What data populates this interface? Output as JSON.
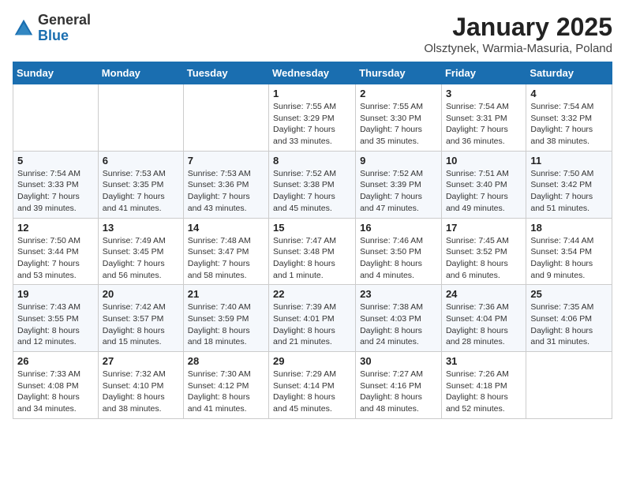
{
  "header": {
    "logo_general": "General",
    "logo_blue": "Blue",
    "month_year": "January 2025",
    "location": "Olsztynek, Warmia-Masuria, Poland"
  },
  "weekdays": [
    "Sunday",
    "Monday",
    "Tuesday",
    "Wednesday",
    "Thursday",
    "Friday",
    "Saturday"
  ],
  "weeks": [
    [
      {
        "day": "",
        "info": ""
      },
      {
        "day": "",
        "info": ""
      },
      {
        "day": "",
        "info": ""
      },
      {
        "day": "1",
        "info": "Sunrise: 7:55 AM\nSunset: 3:29 PM\nDaylight: 7 hours\nand 33 minutes."
      },
      {
        "day": "2",
        "info": "Sunrise: 7:55 AM\nSunset: 3:30 PM\nDaylight: 7 hours\nand 35 minutes."
      },
      {
        "day": "3",
        "info": "Sunrise: 7:54 AM\nSunset: 3:31 PM\nDaylight: 7 hours\nand 36 minutes."
      },
      {
        "day": "4",
        "info": "Sunrise: 7:54 AM\nSunset: 3:32 PM\nDaylight: 7 hours\nand 38 minutes."
      }
    ],
    [
      {
        "day": "5",
        "info": "Sunrise: 7:54 AM\nSunset: 3:33 PM\nDaylight: 7 hours\nand 39 minutes."
      },
      {
        "day": "6",
        "info": "Sunrise: 7:53 AM\nSunset: 3:35 PM\nDaylight: 7 hours\nand 41 minutes."
      },
      {
        "day": "7",
        "info": "Sunrise: 7:53 AM\nSunset: 3:36 PM\nDaylight: 7 hours\nand 43 minutes."
      },
      {
        "day": "8",
        "info": "Sunrise: 7:52 AM\nSunset: 3:38 PM\nDaylight: 7 hours\nand 45 minutes."
      },
      {
        "day": "9",
        "info": "Sunrise: 7:52 AM\nSunset: 3:39 PM\nDaylight: 7 hours\nand 47 minutes."
      },
      {
        "day": "10",
        "info": "Sunrise: 7:51 AM\nSunset: 3:40 PM\nDaylight: 7 hours\nand 49 minutes."
      },
      {
        "day": "11",
        "info": "Sunrise: 7:50 AM\nSunset: 3:42 PM\nDaylight: 7 hours\nand 51 minutes."
      }
    ],
    [
      {
        "day": "12",
        "info": "Sunrise: 7:50 AM\nSunset: 3:44 PM\nDaylight: 7 hours\nand 53 minutes."
      },
      {
        "day": "13",
        "info": "Sunrise: 7:49 AM\nSunset: 3:45 PM\nDaylight: 7 hours\nand 56 minutes."
      },
      {
        "day": "14",
        "info": "Sunrise: 7:48 AM\nSunset: 3:47 PM\nDaylight: 7 hours\nand 58 minutes."
      },
      {
        "day": "15",
        "info": "Sunrise: 7:47 AM\nSunset: 3:48 PM\nDaylight: 8 hours\nand 1 minute."
      },
      {
        "day": "16",
        "info": "Sunrise: 7:46 AM\nSunset: 3:50 PM\nDaylight: 8 hours\nand 4 minutes."
      },
      {
        "day": "17",
        "info": "Sunrise: 7:45 AM\nSunset: 3:52 PM\nDaylight: 8 hours\nand 6 minutes."
      },
      {
        "day": "18",
        "info": "Sunrise: 7:44 AM\nSunset: 3:54 PM\nDaylight: 8 hours\nand 9 minutes."
      }
    ],
    [
      {
        "day": "19",
        "info": "Sunrise: 7:43 AM\nSunset: 3:55 PM\nDaylight: 8 hours\nand 12 minutes."
      },
      {
        "day": "20",
        "info": "Sunrise: 7:42 AM\nSunset: 3:57 PM\nDaylight: 8 hours\nand 15 minutes."
      },
      {
        "day": "21",
        "info": "Sunrise: 7:40 AM\nSunset: 3:59 PM\nDaylight: 8 hours\nand 18 minutes."
      },
      {
        "day": "22",
        "info": "Sunrise: 7:39 AM\nSunset: 4:01 PM\nDaylight: 8 hours\nand 21 minutes."
      },
      {
        "day": "23",
        "info": "Sunrise: 7:38 AM\nSunset: 4:03 PM\nDaylight: 8 hours\nand 24 minutes."
      },
      {
        "day": "24",
        "info": "Sunrise: 7:36 AM\nSunset: 4:04 PM\nDaylight: 8 hours\nand 28 minutes."
      },
      {
        "day": "25",
        "info": "Sunrise: 7:35 AM\nSunset: 4:06 PM\nDaylight: 8 hours\nand 31 minutes."
      }
    ],
    [
      {
        "day": "26",
        "info": "Sunrise: 7:33 AM\nSunset: 4:08 PM\nDaylight: 8 hours\nand 34 minutes."
      },
      {
        "day": "27",
        "info": "Sunrise: 7:32 AM\nSunset: 4:10 PM\nDaylight: 8 hours\nand 38 minutes."
      },
      {
        "day": "28",
        "info": "Sunrise: 7:30 AM\nSunset: 4:12 PM\nDaylight: 8 hours\nand 41 minutes."
      },
      {
        "day": "29",
        "info": "Sunrise: 7:29 AM\nSunset: 4:14 PM\nDaylight: 8 hours\nand 45 minutes."
      },
      {
        "day": "30",
        "info": "Sunrise: 7:27 AM\nSunset: 4:16 PM\nDaylight: 8 hours\nand 48 minutes."
      },
      {
        "day": "31",
        "info": "Sunrise: 7:26 AM\nSunset: 4:18 PM\nDaylight: 8 hours\nand 52 minutes."
      },
      {
        "day": "",
        "info": ""
      }
    ]
  ]
}
